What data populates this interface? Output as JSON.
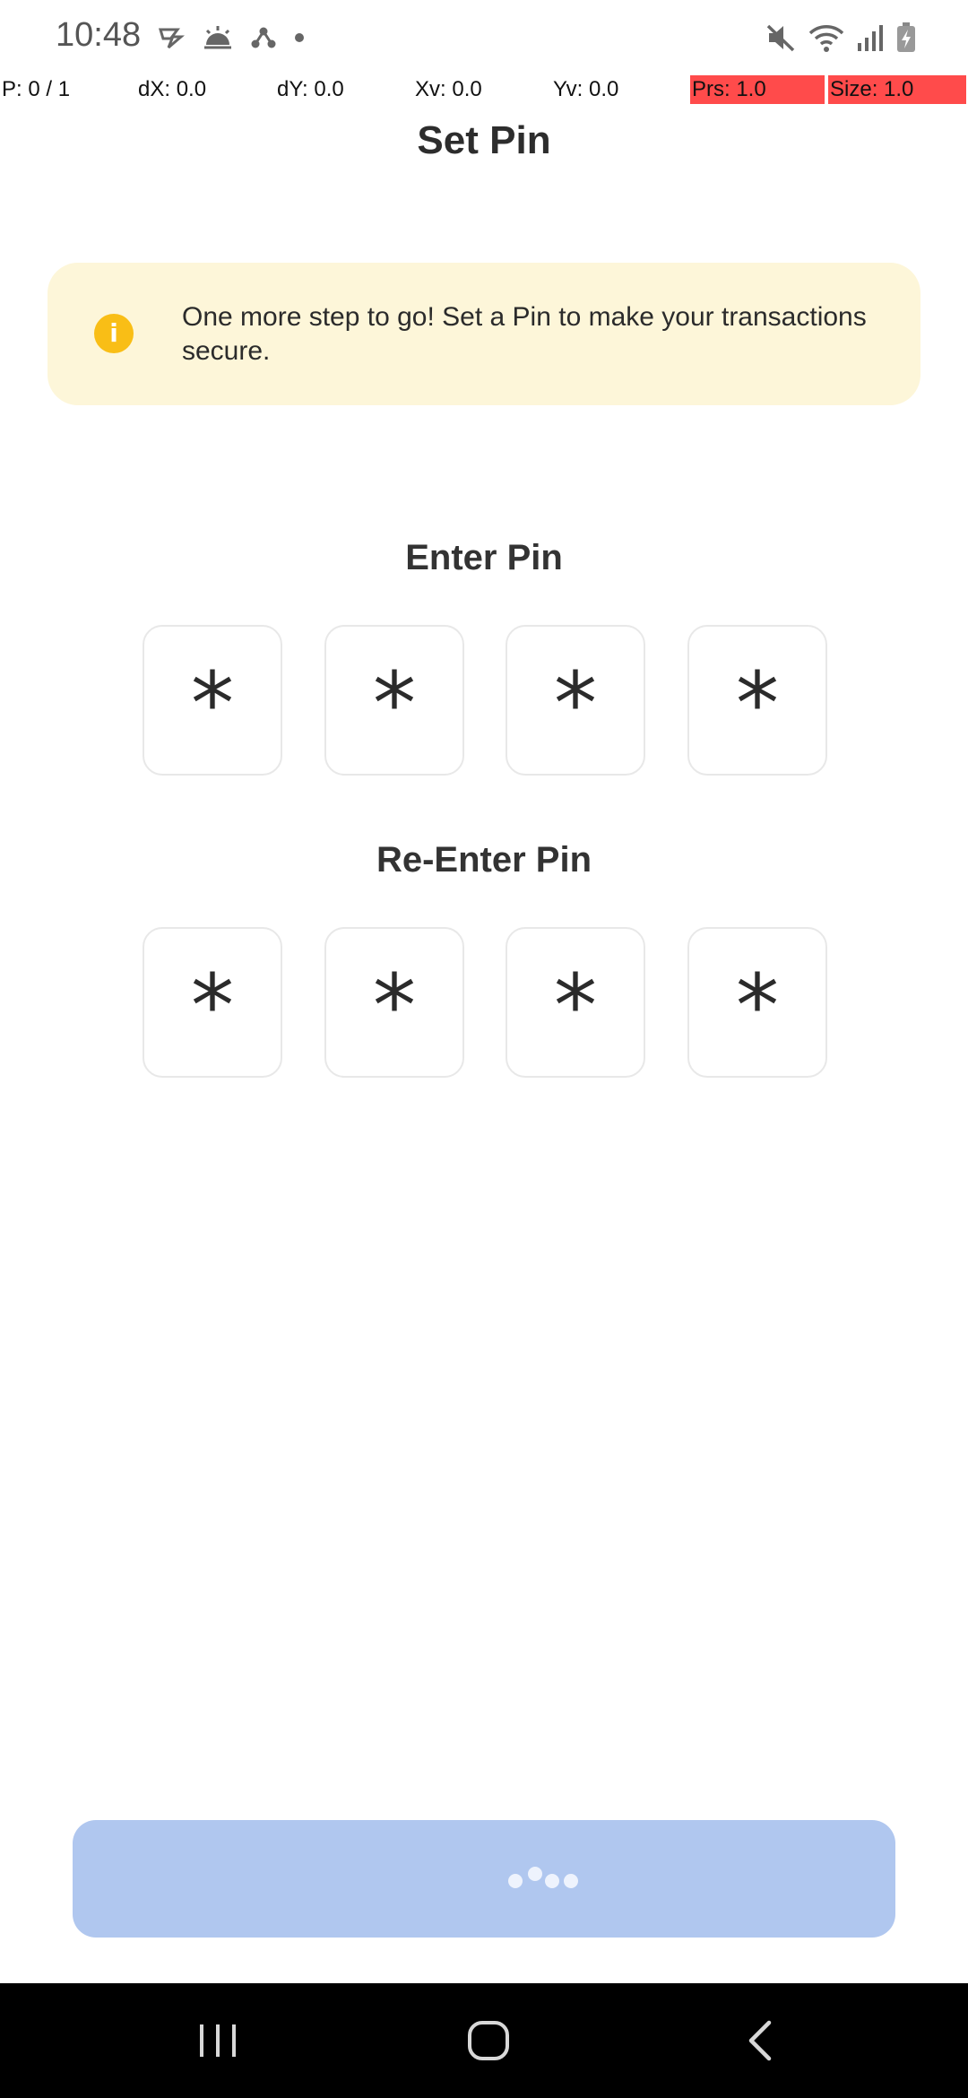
{
  "status_bar": {
    "time": "10:48",
    "left_icons": [
      "app-notification-icon",
      "weather-sunrise-icon",
      "share-network-icon",
      "dot-icon"
    ],
    "right_icons": [
      "mute-icon",
      "wifi-icon",
      "signal-icon",
      "battery-charging-icon"
    ]
  },
  "debug": {
    "pointer": "P: 0 / 1",
    "dx": "dX: 0.0",
    "dy": "dY: 0.0",
    "xv": "Xv: 0.0",
    "yv": "Yv: 0.0",
    "prs": "Prs: 1.0",
    "size": "Size: 1.0"
  },
  "header": {
    "title": "Set Pin"
  },
  "banner": {
    "icon": "info-icon",
    "icon_glyph": "i",
    "text": "One more step to go! Set a Pin to make your transactions secure.",
    "bg_color": "#fdf6d9",
    "icon_color": "#f9be16"
  },
  "enter_pin": {
    "label": "Enter Pin",
    "digits": [
      "*",
      "*",
      "*",
      "*"
    ]
  },
  "reenter_pin": {
    "label": "Re-Enter Pin",
    "digits": [
      "*",
      "*",
      "*",
      "*"
    ]
  },
  "submit": {
    "state": "loading",
    "color": "#b0c7ef"
  },
  "nav": {
    "buttons": [
      "recent-apps-icon",
      "home-icon",
      "back-icon"
    ]
  }
}
